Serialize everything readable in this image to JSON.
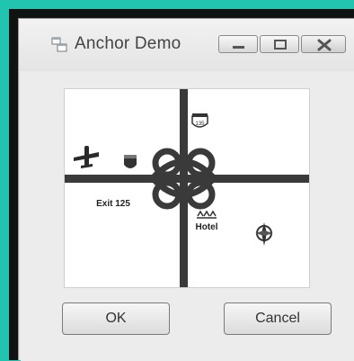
{
  "window": {
    "title": "Anchor Demo",
    "icon": "app-window-icon"
  },
  "titlebar_buttons": {
    "minimize_icon": "minimize-icon",
    "maximize_icon": "maximize-icon",
    "close_icon": "close-icon"
  },
  "map": {
    "exit_label": "Exit 125",
    "hotel_label": "Hotel",
    "icons": [
      "airplane-icon",
      "interstate-shield-icon",
      "highway-shield-icon",
      "hotel-icon",
      "compass-icon"
    ]
  },
  "buttons": {
    "ok_label": "OK",
    "cancel_label": "Cancel"
  },
  "colors": {
    "background": "#21c4ae",
    "window": "#e6e6e6",
    "road": "#3a3a3a"
  }
}
